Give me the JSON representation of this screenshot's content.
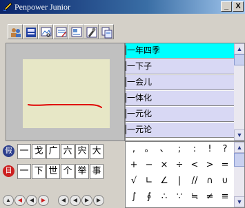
{
  "window": {
    "title": "Penpower Junior",
    "minimize_label": "_",
    "close_label": "X"
  },
  "toolbar": [
    {
      "icon": "users-icon"
    },
    {
      "icon": "dictionary-icon"
    },
    {
      "icon": "image-search-icon"
    },
    {
      "icon": "text-edit-icon"
    },
    {
      "icon": "document-edit-icon"
    },
    {
      "icon": "tools-icon"
    },
    {
      "icon": "copy-icon"
    }
  ],
  "candidates": [
    "一年四季",
    "一下子",
    "一会儿",
    "一体化",
    "一元化",
    "一元论"
  ],
  "selected_index": 0,
  "colors": {
    "selection": "#00ffff",
    "list_bg": "#d8d8f4",
    "stroke": "#e00000",
    "pad_bg": "#e7e7c6"
  },
  "word_rows": [
    {
      "icon_label": "假",
      "icon_color": "#2c3e8c",
      "chars": [
        "一",
        "戈",
        "广",
        "六",
        "宍",
        "大"
      ]
    },
    {
      "icon_label": "目",
      "icon_color": "#cc2020",
      "chars": [
        "一",
        "下",
        "世",
        "个",
        "举",
        "事"
      ]
    }
  ],
  "nav_buttons": [
    {
      "glyph": "▲",
      "color": "#2a2a2a"
    },
    {
      "glyph": "◀",
      "color": "#cc2020"
    },
    {
      "glyph": "◀",
      "color": "#2a2a2a"
    },
    {
      "glyph": "▶",
      "color": "#cc2020"
    },
    {
      "glyph": "◀",
      "color": "#2a2a2a"
    },
    {
      "glyph": "◀",
      "color": "#2a2a2a"
    },
    {
      "glyph": "▶",
      "color": "#2a2a2a"
    },
    {
      "glyph": "▶",
      "color": "#2a2a2a"
    }
  ],
  "symbol_rows": [
    [
      ",",
      "。",
      "、",
      ";",
      ":",
      "!",
      "?"
    ],
    [
      "+",
      "−",
      "×",
      "÷",
      "<",
      ">",
      "="
    ],
    [
      "√",
      "∟",
      "∠",
      "|",
      "//",
      "∩",
      "∪"
    ],
    [
      "∫",
      "∮",
      "∴",
      "∵",
      "≒",
      "≠",
      "≡"
    ]
  ],
  "scroll": {
    "up": "▲",
    "down": "▼"
  }
}
